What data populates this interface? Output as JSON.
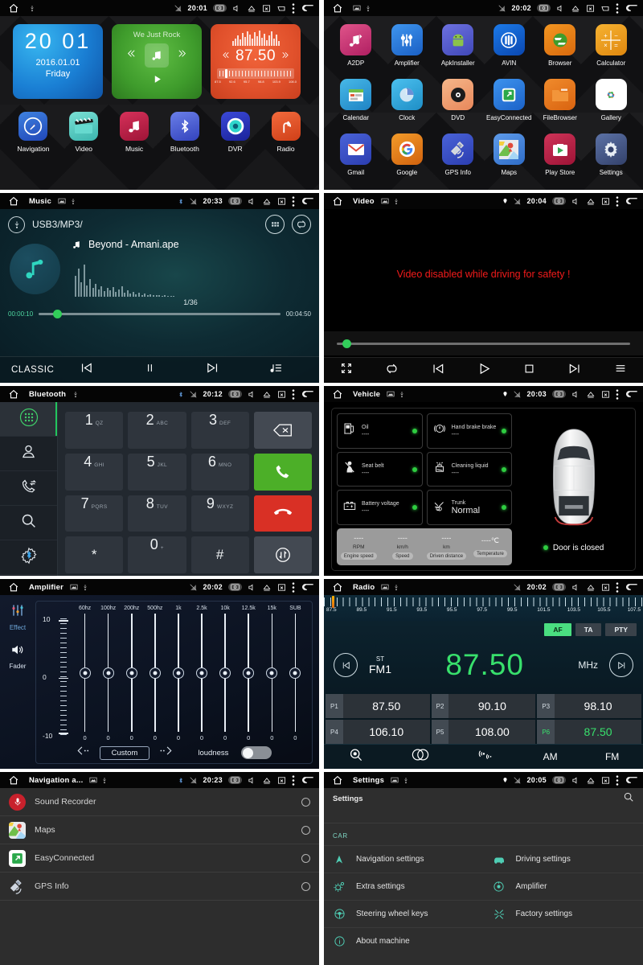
{
  "panels": {
    "home": {
      "status": {
        "time": "20:01"
      },
      "clock_widget": {
        "hours": "20",
        "minutes": "01",
        "date": "2016.01.01",
        "day": "Friday"
      },
      "music_widget": {
        "title": "We Just Rock"
      },
      "radio_widget": {
        "frequency": "87.50",
        "scale_labels": [
          "87.5",
          "92.6",
          "95.7",
          "98.8",
          "103.9",
          "108.0"
        ]
      },
      "dock": [
        {
          "label": "Navigation",
          "icon": "compass-icon",
          "color": "#2f6fd0"
        },
        {
          "label": "Video",
          "icon": "clapperboard-icon",
          "color": "#4fd1c5"
        },
        {
          "label": "Music",
          "icon": "music-note-icon",
          "color": "#c31f45"
        },
        {
          "label": "Bluetooth",
          "icon": "bluetooth-icon",
          "color": "#4a5fd0"
        },
        {
          "label": "DVR",
          "icon": "dvr-lens-icon",
          "color": "#2433b5"
        },
        {
          "label": "Radio",
          "icon": "radio-tower-icon",
          "color": "#e4532a"
        }
      ]
    },
    "apps": {
      "status": {
        "time": "20:02"
      },
      "items": [
        {
          "label": "A2DP",
          "icon": "a2dp-icon",
          "color": "#d9447e"
        },
        {
          "label": "Amplifier",
          "icon": "equalizer-icon",
          "color": "#2a7ee0"
        },
        {
          "label": "ApkInstaller",
          "icon": "android-icon",
          "color": "#5f63d8"
        },
        {
          "label": "AVIN",
          "icon": "avin-icon",
          "color": "#0b63ce"
        },
        {
          "label": "Browser",
          "icon": "browser-icon",
          "color": "#e8891f"
        },
        {
          "label": "Calculator",
          "icon": "calculator-icon",
          "color": "#f2a31c"
        },
        {
          "label": "Calendar",
          "icon": "calendar-icon",
          "color": "#2fa8dc"
        },
        {
          "label": "Clock",
          "icon": "clock-icon",
          "color": "#3ab5e8"
        },
        {
          "label": "DVD",
          "icon": "dvd-disc-icon",
          "color": "#f0a06a"
        },
        {
          "label": "EasyConnected",
          "icon": "easyconnected-icon",
          "color": "#2a7ee0"
        },
        {
          "label": "FileBrowser",
          "icon": "folder-icon",
          "color": "#ea7b1d"
        },
        {
          "label": "Gallery",
          "icon": "gallery-icon",
          "color": "#ffffff"
        },
        {
          "label": "Gmail",
          "icon": "gmail-icon",
          "color": "#3b5bdb"
        },
        {
          "label": "Google",
          "icon": "google-icon",
          "color": "#e8821f"
        },
        {
          "label": "GPS Info",
          "icon": "satellite-icon",
          "color": "#3b5bdb"
        },
        {
          "label": "Maps",
          "icon": "maps-icon",
          "color": "#3b7bdb"
        },
        {
          "label": "Play Store",
          "icon": "play-store-icon",
          "color": "#c1274d"
        },
        {
          "label": "Settings",
          "icon": "gear-icon",
          "color": "#4a5d8f"
        }
      ]
    },
    "music": {
      "status": {
        "title": "Music",
        "time": "20:33"
      },
      "source_path": "USB3/MP3/",
      "track_title": "Beyond - Amani.ape",
      "track_index": "1/36",
      "elapsed": "00:00:10",
      "duration": "00:04:50",
      "eq_preset": "CLASSIC",
      "progress_percent": 6
    },
    "video": {
      "status": {
        "title": "Video",
        "time": "20:04"
      },
      "message": "Video disabled while driving for safety !",
      "progress_percent": 2
    },
    "bluetooth": {
      "status": {
        "title": "Bluetooth",
        "time": "20:12"
      },
      "sidebar": [
        "dialpad-icon",
        "contacts-icon",
        "call-history-icon",
        "search-icon",
        "bluetooth-settings-icon"
      ],
      "keys": [
        {
          "digit": "1",
          "sub": "QZ"
        },
        {
          "digit": "2",
          "sub": "ABC"
        },
        {
          "digit": "3",
          "sub": "DEF"
        },
        {
          "digit": "4",
          "sub": "GHI"
        },
        {
          "digit": "5",
          "sub": "JKL"
        },
        {
          "digit": "6",
          "sub": "MNO"
        },
        {
          "digit": "7",
          "sub": "PQRS"
        },
        {
          "digit": "8",
          "sub": "TUV"
        },
        {
          "digit": "9",
          "sub": "WXYZ"
        },
        {
          "digit": "*",
          "sub": ""
        },
        {
          "digit": "0",
          "sub": "+"
        },
        {
          "digit": "#",
          "sub": ""
        }
      ],
      "actions": [
        "backspace-icon",
        "call-answer-icon",
        "call-end-icon",
        "transfer-audio-icon"
      ]
    },
    "vehicle": {
      "status": {
        "title": "Vehicle",
        "time": "20:03"
      },
      "cells": [
        {
          "label": "Oil",
          "value": "----",
          "icon": "fuel-pump-icon",
          "status_color": "#2ecc40"
        },
        {
          "label": "Hand brake brake",
          "value": "----",
          "icon": "handbrake-icon",
          "status_color": "#2ecc40"
        },
        {
          "label": "Seat belt",
          "value": "----",
          "icon": "seatbelt-icon",
          "status_color": "#2ecc40"
        },
        {
          "label": "Cleaning liquid",
          "value": "----",
          "icon": "washer-fluid-icon",
          "status_color": "#2ecc40"
        },
        {
          "label": "Battery voltage",
          "value": "----",
          "icon": "battery-icon",
          "status_color": "#2ecc40"
        },
        {
          "label": "Trunk",
          "value": "Normal",
          "icon": "trunk-icon",
          "status_color": "#2ecc40"
        }
      ],
      "meters": [
        {
          "value": "----",
          "unit": "RPM",
          "name": "Engine speed"
        },
        {
          "value": "----",
          "unit": "km/h",
          "name": "Speed"
        },
        {
          "value": "----",
          "unit": "km",
          "name": "Driven distance"
        },
        {
          "value": "----℃",
          "unit": "",
          "name": "Temperature"
        }
      ],
      "door_status": "Door is closed"
    },
    "amplifier": {
      "status": {
        "title": "Amplifier",
        "time": "20:02"
      },
      "tabs": [
        {
          "label": "Effect",
          "icon": "equalizer-icon"
        },
        {
          "label": "Fader",
          "icon": "speaker-icon"
        }
      ],
      "scale": {
        "top": "10",
        "mid": "0",
        "bottom": "-10"
      },
      "preset": "Custom",
      "loudness_label": "loudness",
      "loudness_on": false
    },
    "radio": {
      "status": {
        "title": "Radio",
        "time": "20:02"
      },
      "scale_labels": [
        "87.5",
        "89.5",
        "91.5",
        "93.5",
        "95.5",
        "97.5",
        "99.5",
        "101.5",
        "103.5",
        "105.5",
        "107.5"
      ],
      "rds": [
        {
          "label": "AF",
          "active": true
        },
        {
          "label": "TA",
          "active": false
        },
        {
          "label": "PTY",
          "active": false
        }
      ],
      "stereo": "ST",
      "band": "FM1",
      "frequency": "87.50",
      "unit": "MHz",
      "presets": [
        {
          "slot": "P1",
          "freq": "87.50",
          "selected": false
        },
        {
          "slot": "P2",
          "freq": "90.10",
          "selected": false
        },
        {
          "slot": "P3",
          "freq": "98.10",
          "selected": false
        },
        {
          "slot": "P4",
          "freq": "106.10",
          "selected": false
        },
        {
          "slot": "P5",
          "freq": "108.00",
          "selected": false
        },
        {
          "slot": "P6",
          "freq": "87.50",
          "selected": true
        }
      ],
      "footer": [
        {
          "label": "",
          "icon": "search-scan-icon"
        },
        {
          "label": "",
          "icon": "stereo-icon"
        },
        {
          "label": "",
          "icon": "local-distance-icon"
        },
        {
          "label": "AM",
          "icon": ""
        },
        {
          "label": "FM",
          "icon": ""
        }
      ]
    },
    "navigation_apps": {
      "status": {
        "title": "Navigation a...",
        "time": "20:23"
      },
      "items": [
        {
          "label": "Sound Recorder",
          "icon": "microphone-icon",
          "selected": false
        },
        {
          "label": "Maps",
          "icon": "maps-icon",
          "selected": false
        },
        {
          "label": "EasyConnected",
          "icon": "easyconnected-icon",
          "selected": false
        },
        {
          "label": "GPS Info",
          "icon": "satellite-icon",
          "selected": false
        }
      ]
    },
    "settings": {
      "status": {
        "title": "Settings",
        "time": "20:05"
      },
      "header": "Settings",
      "section": "CAR",
      "items": [
        {
          "label": "Navigation settings",
          "icon": "navigation-arrow-icon"
        },
        {
          "label": "Driving settings",
          "icon": "car-icon"
        },
        {
          "label": "Extra settings",
          "icon": "gears-icon"
        },
        {
          "label": "Amplifier",
          "icon": "amplifier-icon"
        },
        {
          "label": "Steering wheel keys",
          "icon": "steering-wheel-icon"
        },
        {
          "label": "Factory settings",
          "icon": "wrench-icon"
        },
        {
          "label": "About machine",
          "icon": "info-icon"
        }
      ]
    }
  },
  "colors": {
    "accent_green": "#38e06c",
    "alert_red": "#f31b1b",
    "teal": "#7fd7c4",
    "status_ok": "#2ecc40"
  }
}
